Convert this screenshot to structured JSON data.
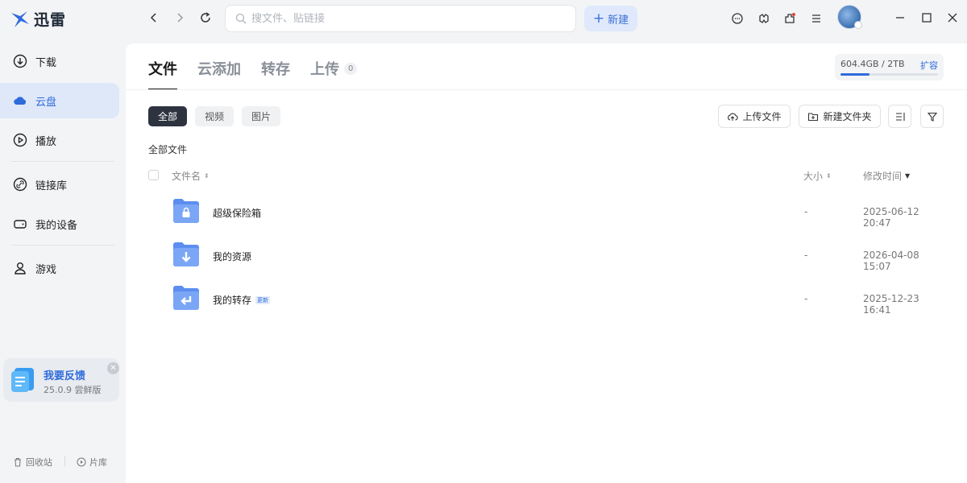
{
  "app": {
    "logo_text": "迅雷"
  },
  "search": {
    "placeholder": "搜文件、贴链接"
  },
  "toolbar": {
    "new_label": "新建"
  },
  "sidebar": {
    "items": [
      {
        "label": "下载",
        "icon": "download-icon"
      },
      {
        "label": "云盘",
        "icon": "cloud-icon"
      },
      {
        "label": "播放",
        "icon": "play-icon"
      },
      {
        "label": "链接库",
        "icon": "link-icon"
      },
      {
        "label": "我的设备",
        "icon": "device-icon"
      },
      {
        "label": "游戏",
        "icon": "user-icon"
      }
    ],
    "active": "云盘",
    "feedback": {
      "title": "我要反馈",
      "subtitle": "25.0.9 尝鲜版"
    },
    "bottom": {
      "recycle": "回收站",
      "library": "片库"
    }
  },
  "tabs": [
    {
      "label": "文件"
    },
    {
      "label": "云添加"
    },
    {
      "label": "转存"
    },
    {
      "label": "上传",
      "badge": "0"
    }
  ],
  "storage": {
    "text": "604.4GB / 2TB",
    "expand": "扩容",
    "used_fraction": 0.3
  },
  "filters": [
    "全部",
    "视频",
    "图片"
  ],
  "actions": {
    "upload": "上传文件",
    "new_folder": "新建文件夹"
  },
  "breadcrumb": "全部文件",
  "table": {
    "columns": {
      "name": "文件名",
      "size": "大小",
      "modified": "修改时间"
    },
    "rows": [
      {
        "name": "超级保险箱",
        "size": "-",
        "modified": "2025-06-12 20:47",
        "folder_icon": "lock-icon"
      },
      {
        "name": "我的资源",
        "size": "-",
        "modified": "2026-04-08 15:07",
        "folder_icon": "download-arrow-icon"
      },
      {
        "name": "我的转存",
        "size": "-",
        "modified": "2025-12-23 16:41",
        "folder_icon": "return-arrow-icon",
        "tag": "更新"
      }
    ]
  },
  "colors": {
    "accent": "#2f6bdc",
    "active_bg": "#dfe8f8",
    "folder": "#5b8ef0"
  }
}
